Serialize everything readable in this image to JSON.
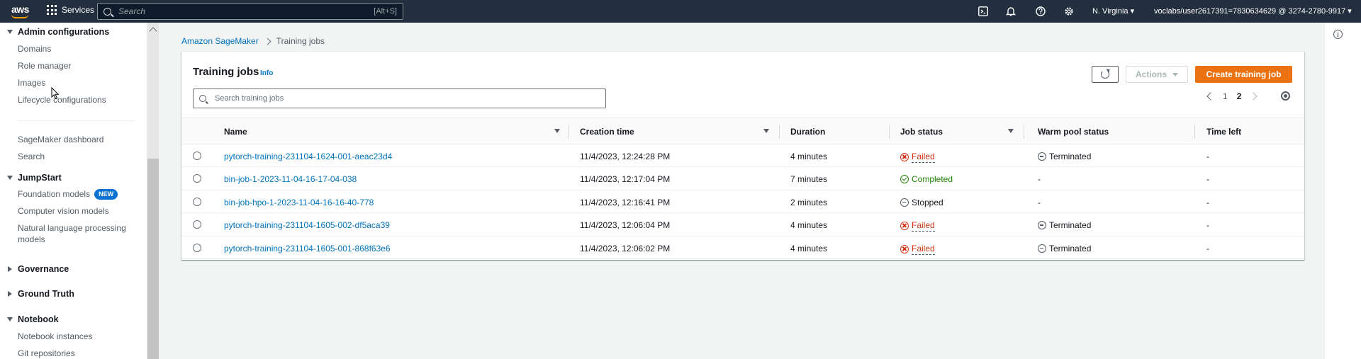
{
  "topnav": {
    "logo_text": "aws",
    "services_label": "Services",
    "search_placeholder": "Search",
    "search_shortcut": "[Alt+S]",
    "region_label": "N. Virginia ▾",
    "account_label": "voclabs/user2617391=7830634629 @ 3274-2780-9917 ▾",
    "icons": [
      "cloudshell-icon",
      "bell-icon",
      "help-icon",
      "gear-icon"
    ]
  },
  "sidebar": {
    "sections": [
      {
        "label": "Admin configurations",
        "expanded": true
      },
      {
        "label": "JumpStart",
        "expanded": true
      },
      {
        "label": "Governance",
        "expanded": false
      },
      {
        "label": "Ground Truth",
        "expanded": false
      },
      {
        "label": "Notebook",
        "expanded": true
      }
    ],
    "admin_items": [
      "Domains",
      "Role manager",
      "Images",
      "Lifecycle configurations"
    ],
    "misc_items": [
      "SageMaker dashboard",
      "Search"
    ],
    "jumpstart_items": [
      "Foundation models",
      "Computer vision models",
      "Natural language processing",
      "models"
    ],
    "new_badge": "NEW",
    "notebook_items": [
      "Notebook instances",
      "Git repositories"
    ]
  },
  "breadcrumb": {
    "parent": "Amazon SageMaker",
    "current": "Training jobs"
  },
  "panel": {
    "title": "Training jobs",
    "info_label": "Info",
    "actions_label": "Actions",
    "create_label": "Create training job",
    "search_placeholder": "Search training jobs",
    "pager": {
      "pages": [
        "1",
        "2"
      ],
      "current_page": "2"
    }
  },
  "table": {
    "columns": [
      "Name",
      "Creation time",
      "Duration",
      "Job status",
      "Warm pool status",
      "Time left"
    ],
    "rows": [
      {
        "name": "pytorch-training-231104-1624-001-aeac23d4",
        "created": "11/4/2023, 12:24:28 PM",
        "duration": "4 minutes",
        "status": "Failed",
        "warm_pool": "Terminated",
        "time_left": "-"
      },
      {
        "name": "bin-job-1-2023-11-04-16-17-04-038",
        "created": "11/4/2023, 12:17:04 PM",
        "duration": "7 minutes",
        "status": "Completed",
        "warm_pool": "-",
        "time_left": "-"
      },
      {
        "name": "bin-job-hpo-1-2023-11-04-16-16-40-778",
        "created": "11/4/2023, 12:16:41 PM",
        "duration": "2 minutes",
        "status": "Stopped",
        "warm_pool": "-",
        "time_left": "-"
      },
      {
        "name": "pytorch-training-231104-1605-002-df5aca39",
        "created": "11/4/2023, 12:06:04 PM",
        "duration": "4 minutes",
        "status": "Failed",
        "warm_pool": "Terminated",
        "time_left": "-"
      },
      {
        "name": "pytorch-training-231104-1605-001-868f63e6",
        "created": "11/4/2023, 12:06:02 PM",
        "duration": "4 minutes",
        "status": "Failed",
        "warm_pool": "Terminated",
        "time_left": "-"
      }
    ]
  },
  "colors": {
    "nav_bg": "#232f3e",
    "primary_button": "#ec7211",
    "link": "#0073bb",
    "failed": "#d13212",
    "completed": "#1d8102"
  }
}
